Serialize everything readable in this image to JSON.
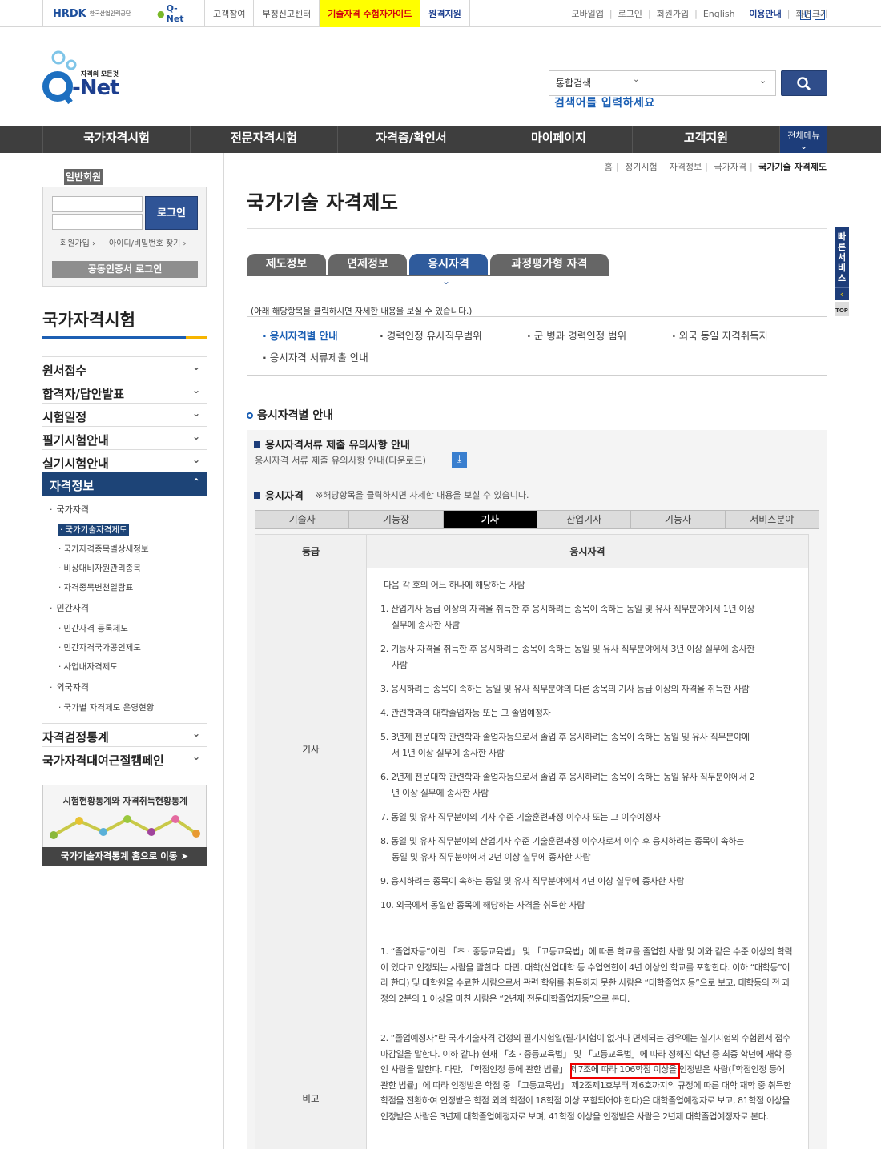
{
  "topbar": {
    "hrdk_logo": "HRDK",
    "hrdk_text": "한국산업인력공단",
    "qnet_logo": "Q-Net",
    "links": [
      "고객참여",
      "부정신고센터"
    ],
    "guide_link": "기술자격 수험자가이드",
    "remote_link": "원격지원",
    "right_links": [
      "모바일앱",
      "로그인",
      "회원가입",
      "English"
    ],
    "usage": "이용안내",
    "zoom_label": "화면크기",
    "zoom_in": "+",
    "zoom_out": "−"
  },
  "header": {
    "logo_tagline": "자격의 모든것",
    "logo_text": "-Net",
    "search_scope": "통합검색",
    "search_placeholder": "검색어를 입력하세요"
  },
  "gnb": {
    "items": [
      "국가자격시험",
      "전문자격시험",
      "자격증/확인서",
      "마이페이지",
      "고객지원"
    ],
    "all_menu": "전체메뉴"
  },
  "login": {
    "title": "일반회원",
    "button": "로그인",
    "join": "회원가입",
    "find": "아이디/비밀번호 찾기",
    "cert_login": "공동인증서 로그인"
  },
  "sidebar": {
    "title": "국가자격시험",
    "menu": [
      "원서접수",
      "합격자/답안발표",
      "시험일정",
      "필기시험안내",
      "실기시험안내",
      "자격정보",
      "자격검정통계",
      "국가자격대여근절캠페인"
    ],
    "sub": {
      "national": "국가자격",
      "national_items": [
        "국가기술자격제도",
        "국가자격종목별상세정보",
        "비상대비자원관리종목",
        "자격종목변천일람표"
      ],
      "private": "민간자격",
      "private_items": [
        "민간자격 등록제도",
        "민간자격국가공인제도",
        "사업내자격제도"
      ],
      "foreign": "외국자격",
      "foreign_items": [
        "국가별 자격제도 운영현황"
      ]
    },
    "stat_title": "시험현황통계와 자격취득현황통계",
    "stat_button": "국가기술자격통계 홈으로 이동"
  },
  "breadcrumb": [
    "홈",
    "정기시험",
    "자격정보",
    "국가자격",
    "국가기술 자격제도"
  ],
  "page_title": "국가기술 자격제도",
  "tabs": [
    "제도정보",
    "면제정보",
    "응시자격",
    "과정평가형 자격"
  ],
  "guide_note": "(아래 해당항목을 클릭하시면 자세한 내용을 보실 수 있습니다.)",
  "sub_items": [
    "응시자격별 안내",
    "경력인정 유사직무범위",
    "군 병과 경력인정 범위",
    "외국 동일 자격취득자",
    "응시자격 서류제출 안내"
  ],
  "section": {
    "heading": "응시자격별 안내",
    "doc_heading": "응시자격서류 제출 유의사항 안내",
    "doc_link": "응시자격 서류 제출 유의사항 안내(다운로드)",
    "qual_heading": "응시자격",
    "qual_note": "※해당항목을 클릭하시면 자세한 내용을 보실 수 있습니다."
  },
  "grade_tabs": [
    "기술사",
    "기능장",
    "기사",
    "산업기사",
    "기능사",
    "서비스분야"
  ],
  "table": {
    "headers": [
      "등급",
      "응시자격"
    ],
    "grade": "기사",
    "intro": "다음 각 호의 어느 하나에 해당하는 사람",
    "items": [
      "1. 산업기사 등급 이상의 자격을 취득한 후 응시하려는 종목이 속하는 동일 및 유사 직무분야에서 1년 이상",
      "실무에 종사한 사람",
      "2. 기능사 자격을 취득한 후 응시하려는 종목이 속하는 동일 및 유사 직무분야에서 3년 이상 실무에 종사한",
      "사람",
      "3. 응시하려는 종목이 속하는 동일 및 유사 직무분야의 다른 종목의 기사 등급 이상의 자격을 취득한 사람",
      "4. 관련학과의 대학졸업자등 또는 그 졸업예정자",
      "5. 3년제 전문대학 관련학과 졸업자등으로서 졸업 후 응시하려는 종목이 속하는 동일 및 유사 직무분야에",
      "서 1년 이상 실무에 종사한 사람",
      "6. 2년제 전문대학 관련학과 졸업자등으로서 졸업 후 응시하려는 종목이 속하는 동일 유사 직무분야에서 2",
      "년 이상 실무에 종사한 사람",
      "7. 동일 및 유사 직무분야의 기사 수준 기술훈련과정 이수자 또는 그 이수예정자",
      "8. 동일 및 유사 직무분야의 산업기사 수준 기술훈련과정 이수자로서 이수 후 응시하려는 종목이 속하는",
      "동일 및 유사 직무분야에서 2년 이상 실무에 종사한 사람",
      "9. 응시하려는 종목이 속하는 동일 및 유사 직무분야에서 4년 이상 실무에 종사한 사람",
      "10. 외국에서 동일한 종목에 해당하는 자격을 취득한 사람"
    ],
    "remark_grade": "비고",
    "remarks": [
      "1. “졸업자등”이란 「초ㆍ중등교육법」 및 「고등교육법」에 따른 학교를 졸업한 사람 및 이와 같은 수준 이상의 학력이 있다고 인정되는 사람을 말한다. 다만, 대학(산업대학 등 수업연한이 4년 이상인 학교를 포함한다. 이하 “대학등”이라 한다) 및 대학원을 수료한 사람으로서 관련 학위를 취득하지 못한 사람은 “대학졸업자등”으로 보고, 대학등의 전 과정의 2분의 1 이상을 마친 사람은 “2년제 전문대학졸업자등”으로 본다.",
      "2. “졸업예정자”란 국가기술자격 검정의 필기시험일(필기시험이 없거나 면제되는 경우에는 실기시험의 수험원서 접수마감일을 말한다. 이하 같다) 현재 「초ㆍ중등교육법」 및 「고등교육법」에 따라 정해진 학년 중 최종 학년에 재학 중인 사람을 말한다. 다만, 「학점인정 등에 관한 법률」 제7조에 따라 106학점 이상을 인정받은 사람(「학점인정 등에 관한 법률」에 따라 인정받은 학점 중 「고등교육법」 제2조제1호부터 제6호까지의 규정에 따른 대학 재학 중 취득한 학점을 전환하여 인정받은 학점 외의 학점이 18학점 이상 포함되어야 한다)은 대학졸업예정자로 보고, 81학점 이상을 인정받은 사람은 3년제 대학졸업예정자로 보며, 41학점 이상을 인정받은 사람은 2년제 대학졸업예정자로 본다."
    ]
  },
  "quick": {
    "label": "빠른서비스",
    "top": "TOP"
  }
}
